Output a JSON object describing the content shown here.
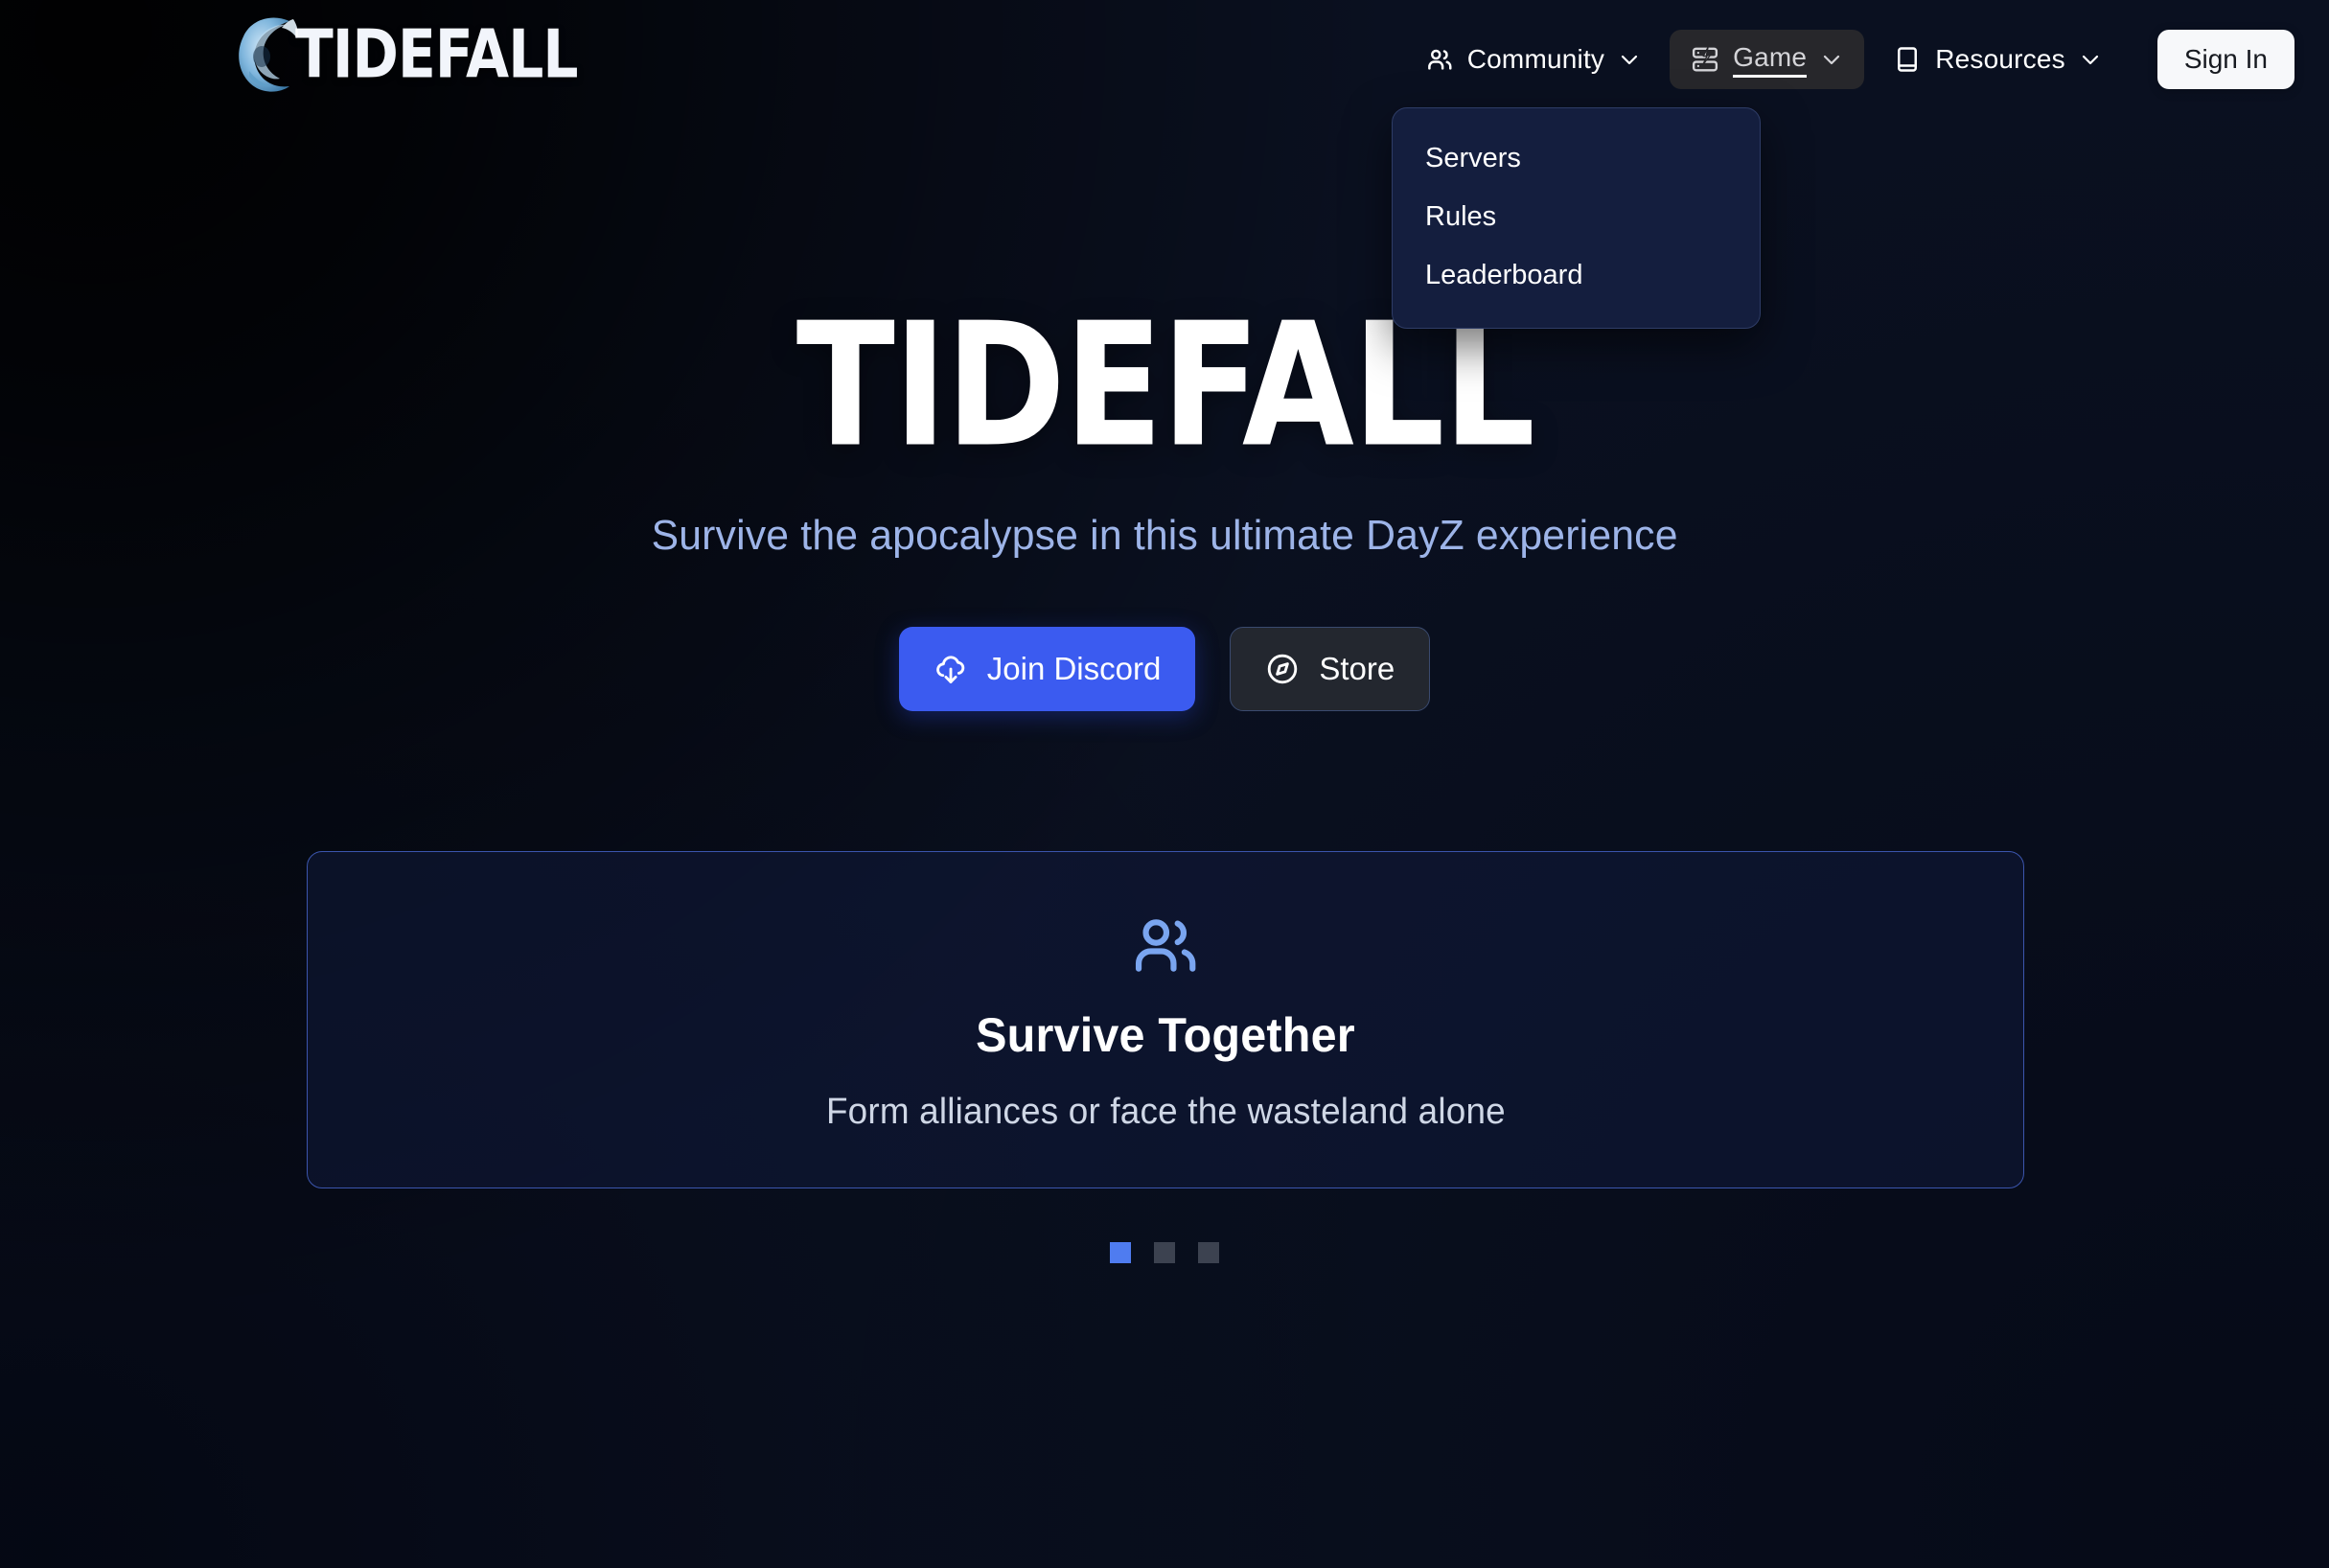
{
  "brand": {
    "name": "TIDEFALL",
    "logo_icon": "wave-globe-icon"
  },
  "navbar": {
    "items": [
      {
        "label": "Community",
        "icon": "users-icon",
        "chevron": "chevron-down-icon",
        "active": false
      },
      {
        "label": "Game",
        "icon": "server-lightning-icon",
        "chevron": "chevron-down-icon",
        "active": true
      },
      {
        "label": "Resources",
        "icon": "book-icon",
        "chevron": "chevron-down-icon",
        "active": false
      }
    ],
    "sign_in_label": "Sign In"
  },
  "game_dropdown": {
    "open": true,
    "items": [
      {
        "label": "Servers"
      },
      {
        "label": "Rules"
      },
      {
        "label": "Leaderboard"
      }
    ]
  },
  "hero": {
    "title": "TIDEFALL",
    "subtitle": "Survive the apocalypse in this ultimate DayZ experience",
    "primary_button": {
      "label": "Join Discord",
      "icon": "cloud-download-icon"
    },
    "secondary_button": {
      "label": "Store",
      "icon": "compass-icon"
    }
  },
  "feature_card": {
    "icon": "users-icon",
    "title": "Survive Together",
    "description": "Form alliances or face the wasteland alone"
  },
  "carousel": {
    "total": 3,
    "active_index": 0
  },
  "colors": {
    "accent_blue": "#3b5bf0",
    "dot_active": "#4f7cf0",
    "dot_inactive": "#3c4250",
    "subtitle_blue": "#9db4e8",
    "card_border": "#3b55ad",
    "signin_bg": "#f7f8fa",
    "nav_active_bg": "#27272b",
    "dropdown_bg": "#141e3e",
    "bg_dark": "#05070f",
    "bg_blue": "#22357f"
  }
}
